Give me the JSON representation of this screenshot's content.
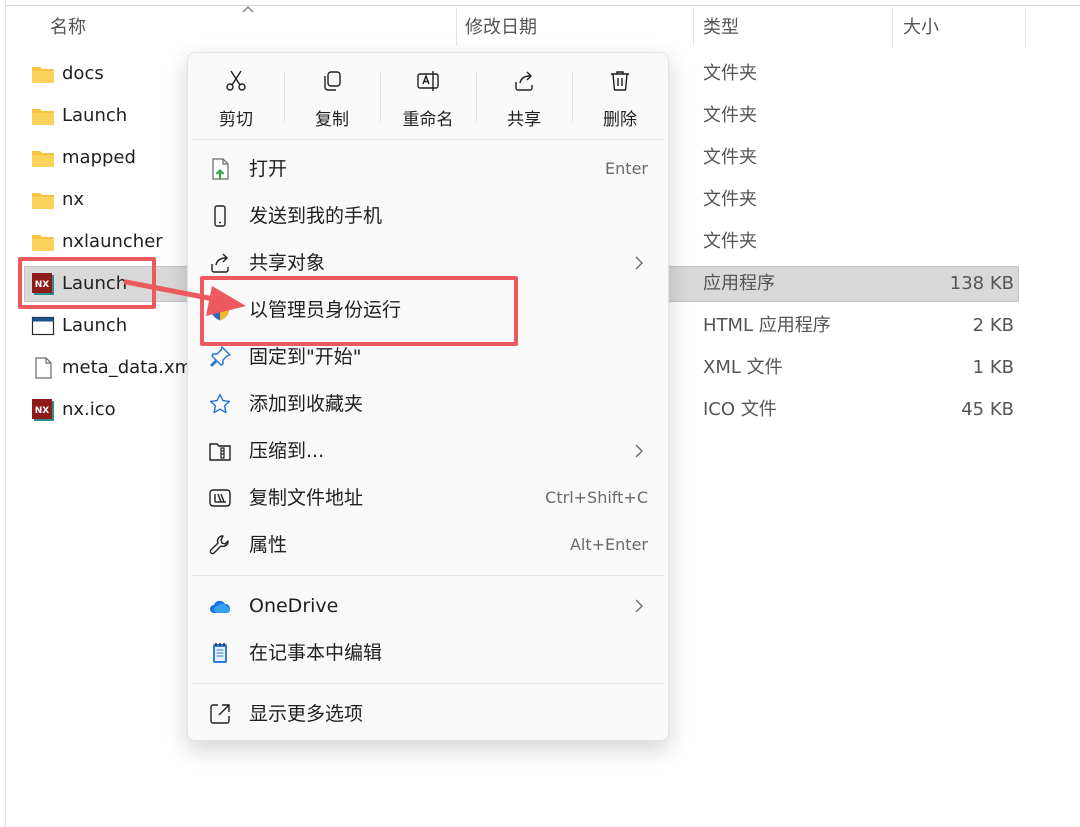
{
  "header": {
    "col_name": "名称",
    "col_date": "修改日期",
    "col_type": "类型",
    "col_size": "大小"
  },
  "files": [
    {
      "name": "docs",
      "type": "文件夹",
      "size": "",
      "icon": "folder-icon"
    },
    {
      "name": "Launch",
      "type": "文件夹",
      "size": "",
      "icon": "folder-icon"
    },
    {
      "name": "mapped",
      "type": "文件夹",
      "size": "",
      "icon": "folder-icon"
    },
    {
      "name": "nx",
      "type": "文件夹",
      "size": "",
      "icon": "folder-icon"
    },
    {
      "name": "nxlauncher",
      "type": "文件夹",
      "size": "",
      "icon": "folder-icon"
    },
    {
      "name": "Launch",
      "type": "应用程序",
      "size": "138 KB",
      "icon": "nx-app-icon",
      "selected": true
    },
    {
      "name": "Launch",
      "type": "HTML 应用程序",
      "size": "2 KB",
      "icon": "window-icon"
    },
    {
      "name": "meta_data.xml",
      "type": "XML 文件",
      "size": "1 KB",
      "icon": "document-icon"
    },
    {
      "name": "nx.ico",
      "type": "ICO 文件",
      "size": "45 KB",
      "icon": "nx-app-icon"
    }
  ],
  "nx_badge": "NX",
  "menu": {
    "quick_actions": [
      {
        "label": "剪切",
        "icon": "scissors-icon"
      },
      {
        "label": "复制",
        "icon": "copy-icon"
      },
      {
        "label": "重命名",
        "icon": "rename-icon"
      },
      {
        "label": "共享",
        "icon": "share-icon"
      },
      {
        "label": "删除",
        "icon": "trash-icon"
      }
    ],
    "items": [
      {
        "label": "打开",
        "shortcut": "Enter",
        "icon": "open-icon"
      },
      {
        "label": "发送到我的手机",
        "shortcut": "",
        "icon": "phone-icon"
      },
      {
        "label": "共享对象",
        "shortcut": "",
        "icon": "share-icon",
        "submenu": true
      },
      {
        "label": "以管理员身份运行",
        "shortcut": "",
        "icon": "shield-icon"
      },
      {
        "label": "固定到\"开始\"",
        "shortcut": "",
        "icon": "pin-icon"
      },
      {
        "label": "添加到收藏夹",
        "shortcut": "",
        "icon": "star-icon"
      },
      {
        "label": "压缩到...",
        "shortcut": "",
        "icon": "zip-icon",
        "submenu": true
      },
      {
        "label": "复制文件地址",
        "shortcut": "Ctrl+Shift+C",
        "icon": "copy-path-icon"
      },
      {
        "label": "属性",
        "shortcut": "Alt+Enter",
        "icon": "wrench-icon"
      },
      {
        "label": "OneDrive",
        "shortcut": "",
        "icon": "cloud-icon",
        "submenu": true
      },
      {
        "label": "在记事本中编辑",
        "shortcut": "",
        "icon": "notepad-icon"
      },
      {
        "label": "显示更多选项",
        "shortcut": "",
        "icon": "more-options-icon"
      }
    ]
  },
  "colors": {
    "annotation_red": "#ec5a5f",
    "folder_yellow": "#f6c342",
    "nx_red": "#8e1a1a",
    "onedrive_blue": "#1a73e8",
    "selected_row": "#d9d9d9"
  }
}
